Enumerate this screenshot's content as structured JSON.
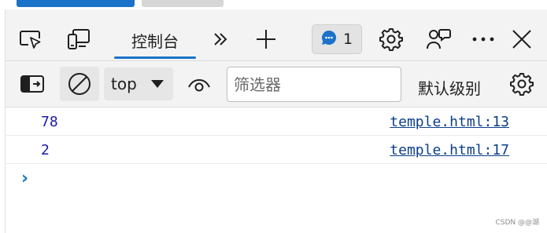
{
  "browser": {
    "top_chip_colors": [
      "#1a73c8",
      "#d6d6d6"
    ]
  },
  "tabbar": {
    "inspect_icon": "inspect-element-icon",
    "device_icon": "device-emulation-icon",
    "console_tab_label": "控制台",
    "more_tabs_icon": "more-tabs-icon",
    "add_tab_icon": "add-tab-icon",
    "issues_icon": "issues-message-icon",
    "issues_count": "1",
    "settings_icon": "gear-icon",
    "feedback_icon": "feedback-icon",
    "more_menu_icon": "more-menu-icon",
    "close_icon": "close-icon",
    "accent_color": "#1a73c8"
  },
  "console_toolbar": {
    "sidebar_icon": "toggle-sidebar-icon",
    "clear_icon": "clear-console-icon",
    "context_value": "top",
    "live_expression_icon": "eye-icon",
    "filter_placeholder": "筛选器",
    "filter_value": "",
    "levels_label": "默认级别",
    "settings_icon": "gear-icon"
  },
  "console_log": [
    {
      "value": "78",
      "source": "temple.html:13"
    },
    {
      "value": "2",
      "source": "temple.html:17"
    }
  ],
  "prompt_symbol": "›",
  "watermark": "CSDN @@湖"
}
